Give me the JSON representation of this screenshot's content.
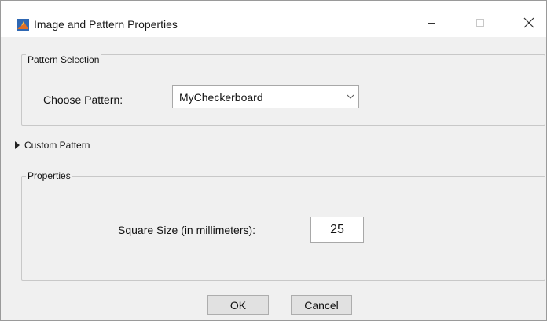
{
  "window": {
    "title": "Image and Pattern Properties",
    "app_icon": "matlab-icon",
    "controls": {
      "minimize_icon": "minimize-icon",
      "maximize_icon": "maximize-icon",
      "close_icon": "close-icon"
    }
  },
  "pattern_selection": {
    "group_label": "Pattern Selection",
    "choose_label": "Choose Pattern:",
    "selected_value": "MyCheckerboard",
    "dropdown_icon": "chevron-down-icon"
  },
  "custom_pattern": {
    "label": "Custom Pattern",
    "expanded": false,
    "toggle_icon": "triangle-right-icon"
  },
  "properties": {
    "group_label": "Properties",
    "square_size_label": "Square Size (in millimeters):",
    "square_size_value": "25"
  },
  "buttons": {
    "ok_label": "OK",
    "cancel_label": "Cancel"
  },
  "colors": {
    "dialog_background": "#f0f0f0",
    "titlebar_background": "#ffffff",
    "button_background": "#e1e1e1",
    "matlab_orange": "#e16f24",
    "matlab_blue": "#2f68b3"
  }
}
